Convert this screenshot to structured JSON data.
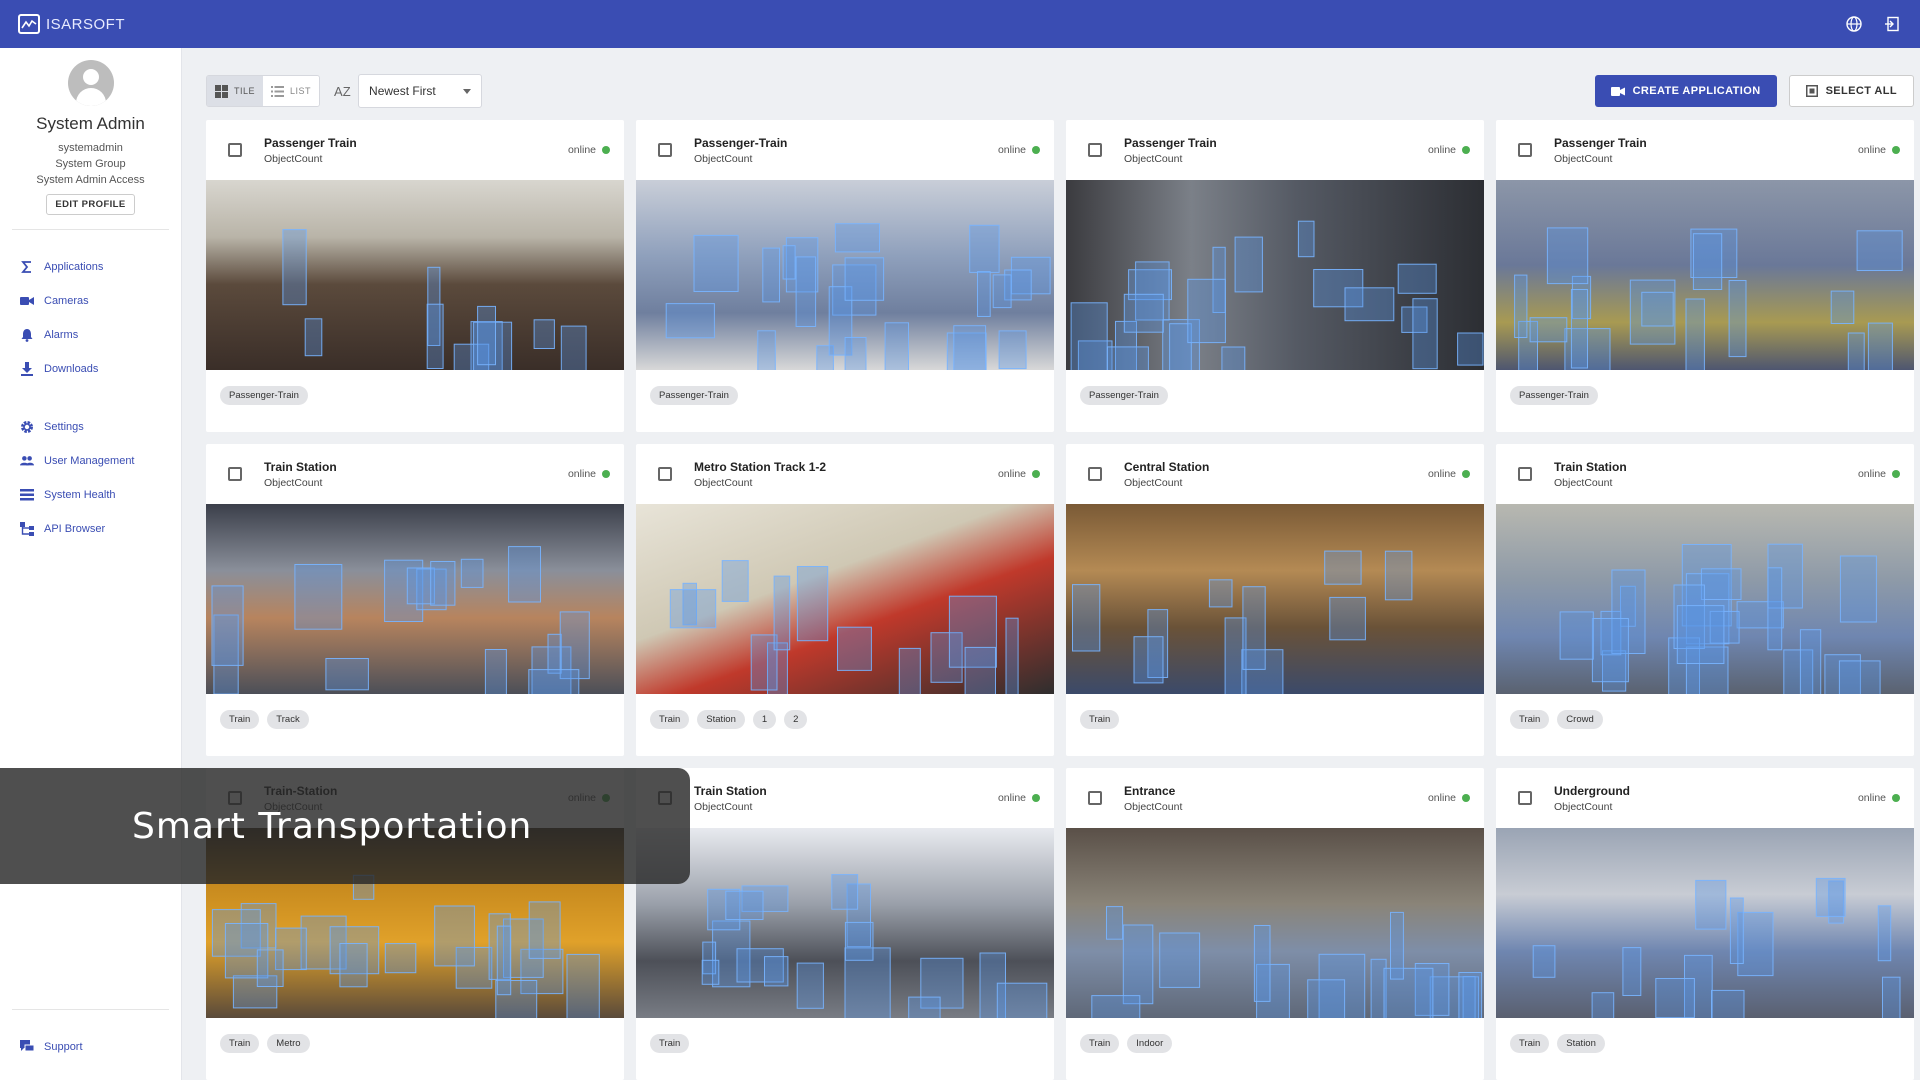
{
  "app": {
    "logo_text": "ISARSOFT"
  },
  "colors": {
    "brand": "#3a4db3",
    "online": "#4caf50"
  },
  "profile": {
    "name": "System Admin",
    "username": "systemadmin",
    "group": "System Group",
    "access": "System Admin Access",
    "edit_label": "EDIT PROFILE"
  },
  "nav": {
    "applications": "Applications",
    "cameras": "Cameras",
    "alarms": "Alarms",
    "downloads": "Downloads",
    "settings": "Settings",
    "user_management": "User Management",
    "system_health": "System Health",
    "api_browser": "API Browser",
    "support": "Support"
  },
  "toolbar": {
    "tile_label": "TILE",
    "list_label": "LIST",
    "sort_icon_label": "AZ",
    "sort_value": "Newest First",
    "create_label": "CREATE APPLICATION",
    "select_all_label": "SELECT ALL"
  },
  "cards": [
    {
      "title": "Passenger Train",
      "subtitle": "ObjectCount",
      "status": "online",
      "tags": [
        "Passenger-Train"
      ],
      "scene": "train-interior"
    },
    {
      "title": "Passenger-Train",
      "subtitle": "ObjectCount",
      "status": "online",
      "tags": [
        "Passenger-Train"
      ],
      "scene": "metro-interior"
    },
    {
      "title": "Passenger Train",
      "subtitle": "ObjectCount",
      "status": "online",
      "tags": [
        "Passenger-Train"
      ],
      "scene": "train-doors"
    },
    {
      "title": "Passenger Train",
      "subtitle": "ObjectCount",
      "status": "online",
      "tags": [
        "Passenger-Train"
      ],
      "scene": "train-aisle"
    },
    {
      "title": "Train Station",
      "subtitle": "ObjectCount",
      "status": "online",
      "tags": [
        "Train",
        "Track"
      ],
      "scene": "station-hall"
    },
    {
      "title": "Metro Station Track 1-2",
      "subtitle": "ObjectCount",
      "status": "online",
      "tags": [
        "Train",
        "Station",
        "1",
        "2"
      ],
      "scene": "metro-platform"
    },
    {
      "title": "Central Station",
      "subtitle": "ObjectCount",
      "status": "online",
      "tags": [
        "Train"
      ],
      "scene": "central-hall"
    },
    {
      "title": "Train Station",
      "subtitle": "ObjectCount",
      "status": "online",
      "tags": [
        "Train",
        "Crowd"
      ],
      "scene": "crowd-platform"
    },
    {
      "title": "Train-Station",
      "subtitle": "ObjectCount",
      "status": "online",
      "tags": [
        "Train",
        "Metro"
      ],
      "scene": "yellow-train"
    },
    {
      "title": "Train Station",
      "subtitle": "ObjectCount",
      "status": "online",
      "tags": [
        "Train"
      ],
      "scene": "arched-roof"
    },
    {
      "title": "Entrance",
      "subtitle": "ObjectCount",
      "status": "online",
      "tags": [
        "Train",
        "Indoor"
      ],
      "scene": "entrance-hall"
    },
    {
      "title": "Underground",
      "subtitle": "ObjectCount",
      "status": "online",
      "tags": [
        "Train",
        "Station"
      ],
      "scene": "underground"
    }
  ],
  "banner": {
    "text": "Smart Transportation"
  }
}
